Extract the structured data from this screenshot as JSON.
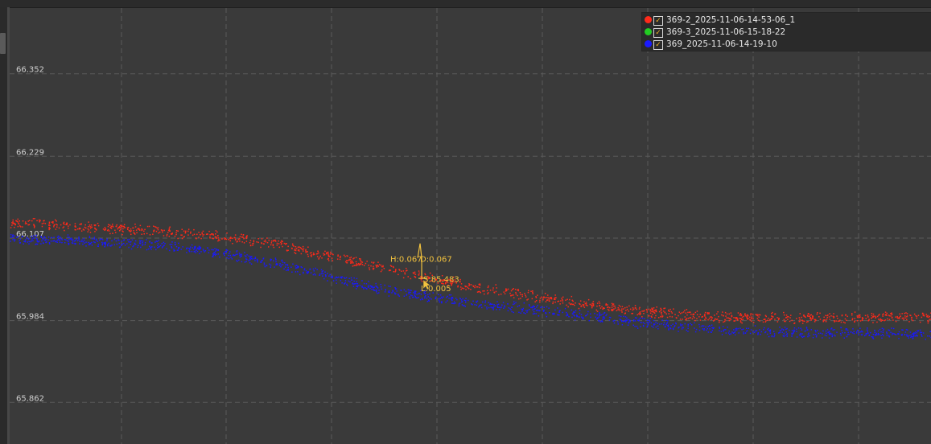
{
  "chart_data": {
    "type": "scatter",
    "x": [
      0,
      2,
      4,
      6,
      8,
      10,
      12,
      14,
      16,
      18,
      20,
      22,
      24,
      26,
      28,
      30,
      32,
      34,
      36,
      38,
      40,
      42,
      44
    ],
    "series": [
      {
        "name": "369-2_2025-11-06-14-53-06_1",
        "color": "#ff2a1a",
        "values": [
          66.132,
          66.128,
          66.124,
          66.12,
          66.116,
          66.11,
          66.102,
          66.09,
          66.076,
          66.062,
          66.048,
          66.036,
          66.026,
          66.016,
          66.007,
          65.999,
          65.994,
          65.99,
          65.989,
          65.989,
          65.989,
          65.99,
          65.989
        ]
      },
      {
        "name": "369-3_2025-11-06-15-18-22",
        "color": "#22cc22",
        "values": []
      },
      {
        "name": "369_2025-11-06-14-19-10",
        "color": "#1a1aff",
        "values": [
          66.107,
          66.105,
          66.102,
          66.099,
          66.094,
          66.086,
          66.074,
          66.06,
          66.044,
          66.03,
          66.02,
          66.012,
          66.005,
          65.998,
          65.99,
          65.982,
          65.976,
          65.971,
          65.968,
          65.967,
          65.967,
          65.966,
          65.963
        ]
      }
    ],
    "y_ticks": [
      "66.352",
      "66.229",
      "66.107",
      "65.984",
      "65.862"
    ],
    "y_tick_values": [
      66.352,
      66.229,
      66.107,
      65.984,
      65.862
    ],
    "ylim": [
      65.8,
      66.45
    ],
    "xlim": [
      0,
      44
    ],
    "grid": true,
    "legend_position": "top-right",
    "title": "",
    "xlabel": "",
    "ylabel": "",
    "measurement": {
      "label_h": "H:0.067",
      "label_d": "D:0.067",
      "label_s": "S:85.483",
      "label_l": "L:0.005",
      "x": 19.6,
      "y_top": 66.099,
      "y_bottom": 66.047,
      "color": "#f2c23e"
    }
  },
  "legend": {
    "items": [
      {
        "label": "369-2_2025-11-06-14-53-06_1",
        "color": "#ff2a1a",
        "checked": true
      },
      {
        "label": "369-3_2025-11-06-15-18-22",
        "color": "#22cc22",
        "checked": true
      },
      {
        "label": "369_2025-11-06-14-19-10",
        "color": "#1a1aff",
        "checked": true
      }
    ]
  },
  "colors": {
    "background": "#3a3a3a",
    "grid": "#5a5a5a",
    "legend_bg": "#2a2a2a"
  }
}
